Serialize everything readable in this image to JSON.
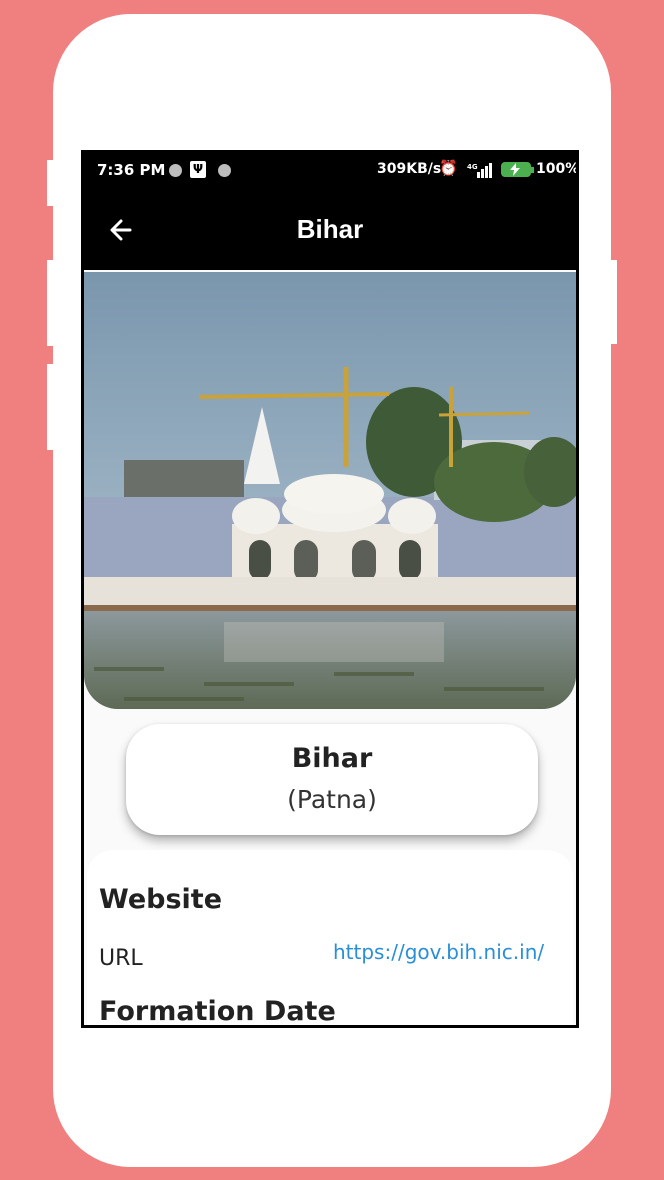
{
  "status_bar": {
    "time": "7:36 PM",
    "network_speed": "309KB/s",
    "network_type": "4G",
    "battery_percent": "100%"
  },
  "app_bar": {
    "title": "Bihar",
    "back_icon": "arrow-back-icon"
  },
  "hero_image": {
    "description_icon": "landmark-photo"
  },
  "name_card": {
    "state": "Bihar",
    "capital": "(Patna)"
  },
  "details": {
    "website_heading": "Website",
    "url_label": "URL",
    "url_value": "https://gov.bih.nic.in/",
    "formation_heading": "Formation Date"
  },
  "colors": {
    "background": "#F08080",
    "link": "#2a8fd6",
    "app_bar": "#000000"
  }
}
